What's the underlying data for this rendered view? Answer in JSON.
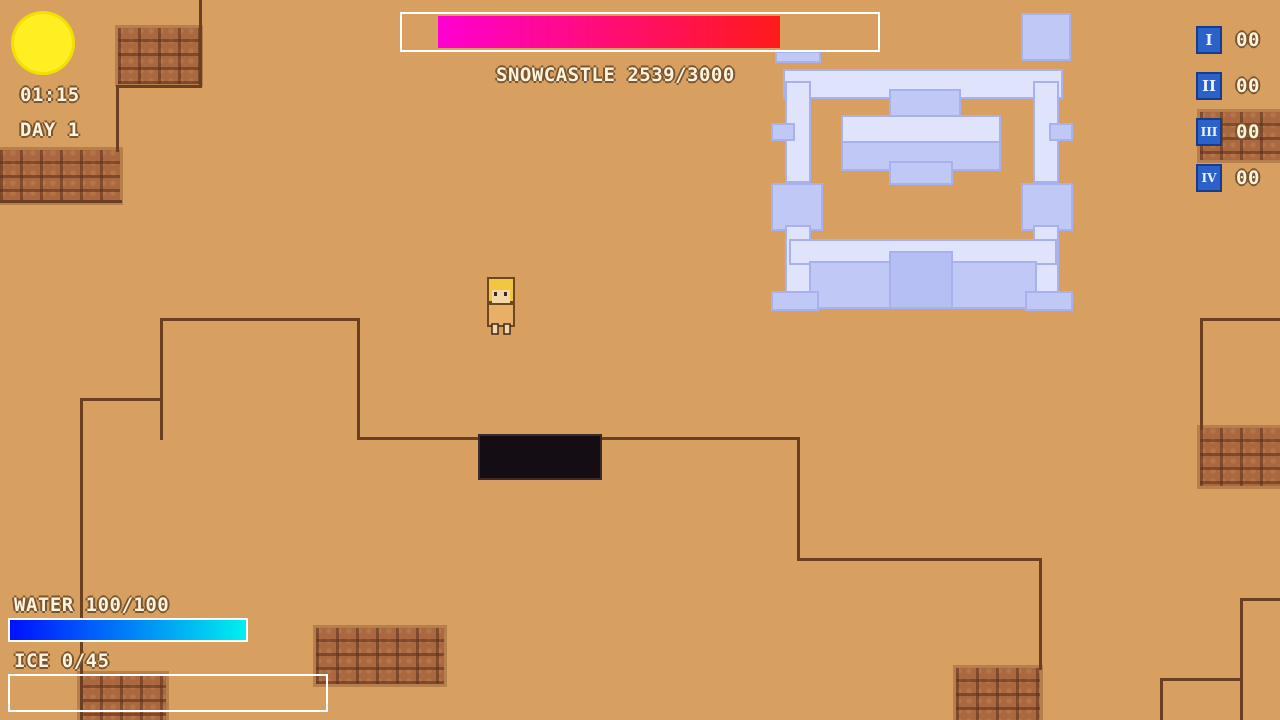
{
  "hud": {
    "time": "01:15",
    "day": "DAY 1",
    "boss_label": "SNOWCASTLE 2539/3000",
    "boss_hp": 2539,
    "boss_hp_max": 3000,
    "water_label": "WATER 100/100",
    "water": 100,
    "water_max": 100,
    "ice_label": "ICE 0/45",
    "ice": 0,
    "ice_max": 45
  },
  "inventory": [
    {
      "numeral": "I",
      "count": "00"
    },
    {
      "numeral": "II",
      "count": "00"
    },
    {
      "numeral": "III",
      "count": "00"
    },
    {
      "numeral": "IV",
      "count": "00"
    }
  ],
  "colors": {
    "sand": "#d8a060",
    "boss_bar_start": "#ff00d0",
    "boss_bar_end": "#ff1a1a",
    "water_bar_start": "#0010ff",
    "water_bar_end": "#00f0f0",
    "castle": "#c8d0f8",
    "sun": "#ffee22"
  }
}
